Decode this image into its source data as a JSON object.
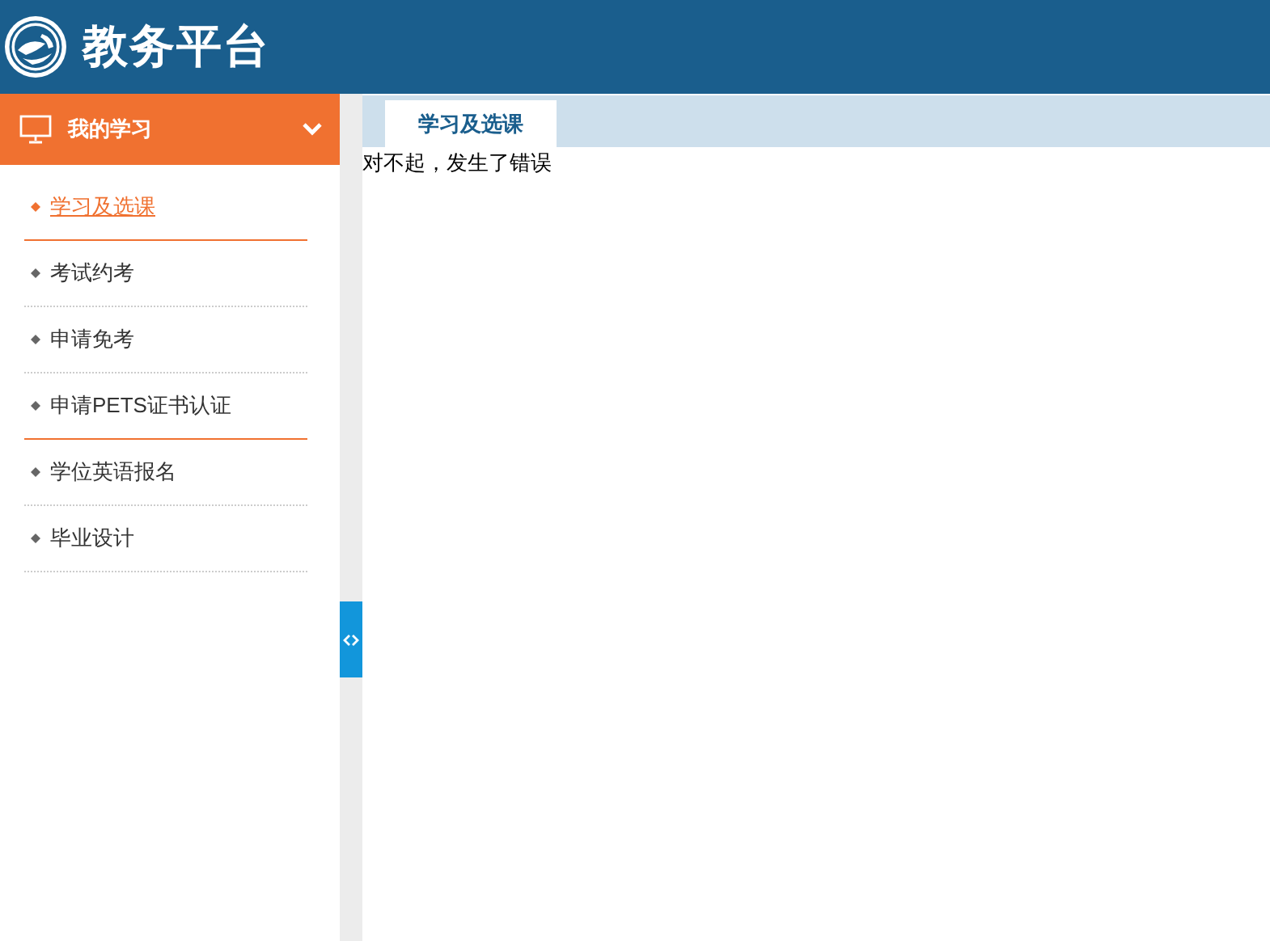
{
  "header": {
    "title": "教务平台"
  },
  "sidebar": {
    "section": {
      "title": "我的学习",
      "expanded": true
    },
    "items": [
      {
        "label": "学习及选课",
        "selected": true,
        "hovered": true
      },
      {
        "label": "考试约考",
        "selected": false,
        "hovered": false
      },
      {
        "label": "申请免考",
        "selected": false,
        "hovered": false
      },
      {
        "label": "申请PETS证书认证",
        "selected": false,
        "hovered": true
      },
      {
        "label": "学位英语报名",
        "selected": false,
        "hovered": false
      },
      {
        "label": "毕业设计",
        "selected": false,
        "hovered": false
      }
    ]
  },
  "tabs": [
    {
      "label": "学习及选课",
      "selected": true
    }
  ],
  "content": {
    "message": "对不起，发生了错误"
  }
}
